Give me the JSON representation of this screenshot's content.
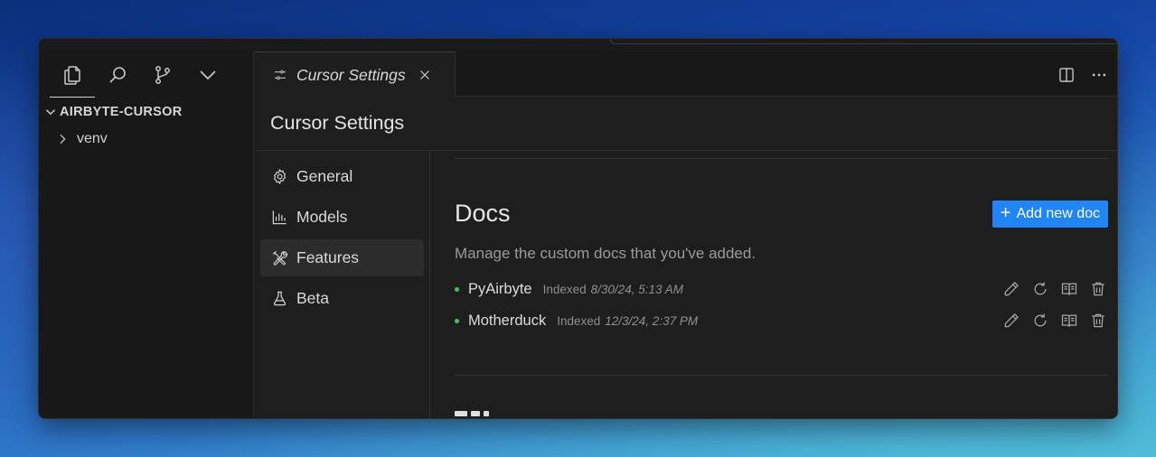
{
  "explorer": {
    "root_label": "AIRBYTE-CURSOR",
    "items": [
      {
        "label": "venv"
      }
    ]
  },
  "activity_bar": {
    "icons": [
      "files-icon",
      "search-icon",
      "source-control-icon",
      "chevron-down-icon"
    ]
  },
  "tab": {
    "label": "Cursor Settings"
  },
  "page": {
    "title": "Cursor Settings"
  },
  "nav": {
    "items": [
      {
        "label": "General",
        "icon": "gear-icon"
      },
      {
        "label": "Models",
        "icon": "chart-icon"
      },
      {
        "label": "Features",
        "icon": "tools-icon",
        "selected": true
      },
      {
        "label": "Beta",
        "icon": "flask-icon"
      }
    ]
  },
  "docs": {
    "title": "Docs",
    "add_button": "Add new doc",
    "description": "Manage the custom docs that you've added.",
    "items": [
      {
        "name": "PyAirbyte",
        "indexed_label": "Indexed",
        "date": "8/30/24, 5:13 AM"
      },
      {
        "name": "Motherduck",
        "indexed_label": "Indexed",
        "date": "12/3/24, 2:37 PM"
      }
    ]
  },
  "colors": {
    "accent": "#2285f5",
    "status_dot": "#4fbe63"
  }
}
